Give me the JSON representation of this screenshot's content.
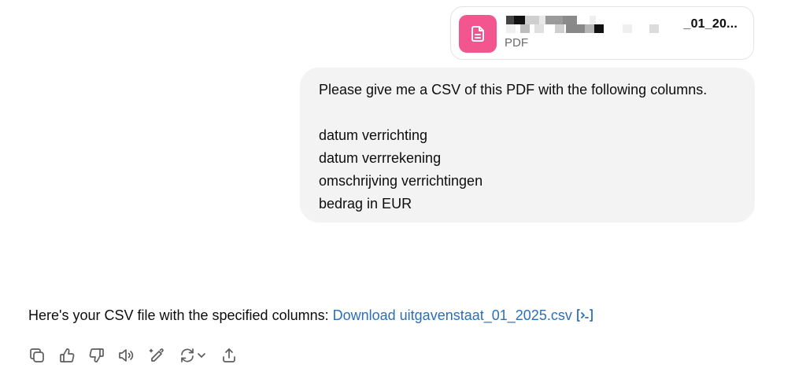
{
  "attachment": {
    "file_name_suffix": "_01_20...",
    "file_type": "PDF",
    "icon": "document-icon"
  },
  "user_message": {
    "line1": "Please give me a CSV of this PDF with the following columns.",
    "columns": [
      "datum verrichting",
      "datum verrrekening",
      "omschrijving verrichtingen",
      "bedrag in EUR"
    ]
  },
  "assistant_message": {
    "text": "Here's your CSV file with the specified columns: ",
    "link_text": "Download uitgavenstaat_01_2025.csv"
  },
  "action_bar": {
    "icons": [
      "copy-icon",
      "thumbs-up-icon",
      "thumbs-down-icon",
      "read-aloud-icon",
      "edit-icon",
      "regenerate-icon",
      "share-icon"
    ]
  },
  "colors": {
    "file_icon_bg": "#f3568f",
    "bubble_bg": "#f3f3f3",
    "link": "#2c6fb6"
  }
}
